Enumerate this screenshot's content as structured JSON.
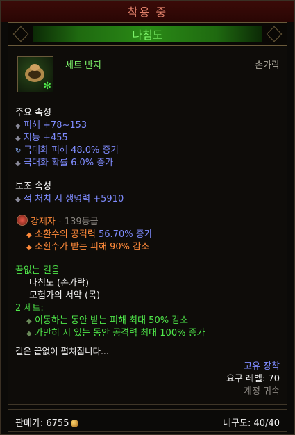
{
  "equipped_label": "착용 중",
  "item": {
    "name": "나침도",
    "type": "세트 반지",
    "slot": "손가락"
  },
  "primary": {
    "header": "주요 속성",
    "stats": [
      "피해 +78~153",
      "지능 +455",
      "극대화 피해 48.0% 증가",
      "극대화 확률 6.0% 증가"
    ]
  },
  "secondary": {
    "header": "보조 속성",
    "stats": [
      "적 처치 시 생명력 +5910"
    ]
  },
  "legendary_gem": {
    "name": "강제자",
    "rank": "- 139등급",
    "effects_prefix": [
      "소환수의 공격력 ",
      "소환수가 받는 피해 90% 감소"
    ],
    "effect1_value": "56.70% 증가"
  },
  "set": {
    "name": "끝없는 걸음",
    "pieces": [
      "나침도 (손가락)",
      "모험가의 서약 (목)"
    ],
    "bonus_header": "2 세트:",
    "bonuses": [
      "이동하는 동안 받는 피해 최대 50% 감소",
      "가만히 서 있는 동안 공격력 최대 100% 증가"
    ]
  },
  "flavor": "길은 끝없이 펼쳐집니다...",
  "meta": {
    "unique": "고유 장착",
    "level_req": "요구 레벨: 70",
    "bound": "계정 귀속"
  },
  "footer": {
    "sell_label": "판매가: 6755",
    "durability": "내구도: 40/40"
  },
  "colors": {
    "set_green": "#4fe84a",
    "magic_blue": "#7f8cff",
    "orange": "#ff8a3a",
    "equipped_red": "#e0806a"
  }
}
